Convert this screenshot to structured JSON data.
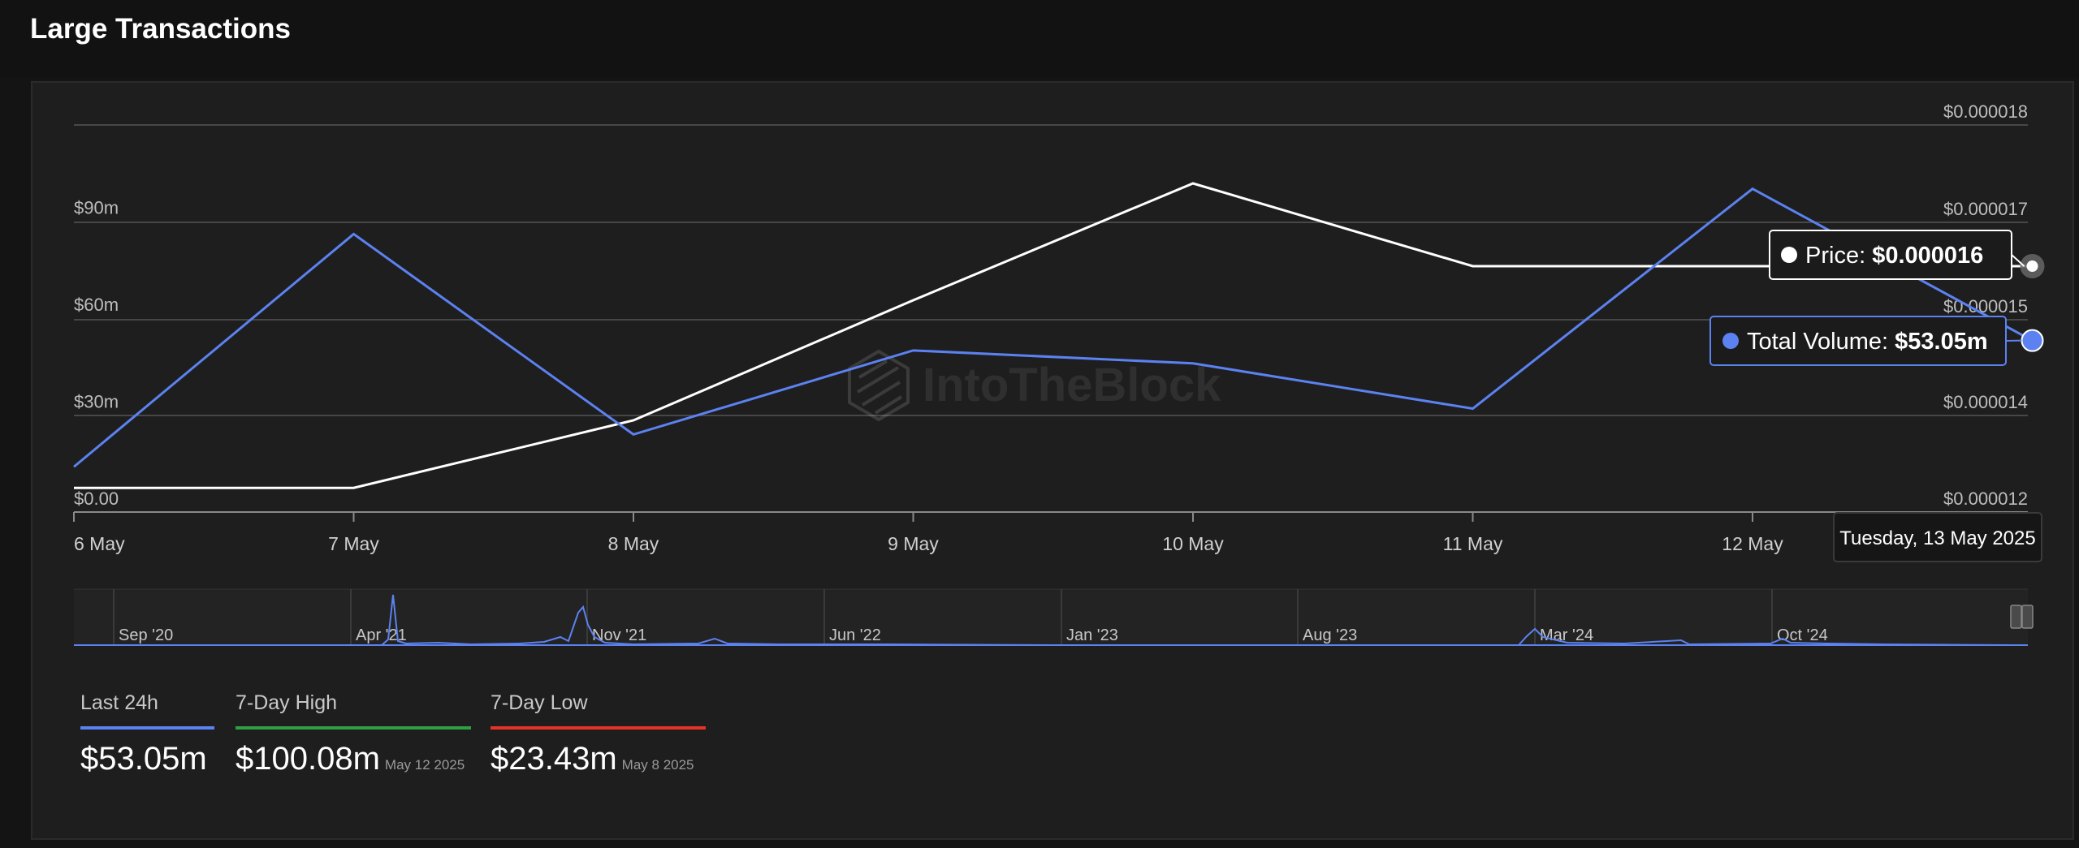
{
  "header": {
    "title": "Large Transactions"
  },
  "colors": {
    "volume": "#5b82f0",
    "price": "#ffffff",
    "high": "#2ea043",
    "low": "#e5332a",
    "grid": "#474747",
    "axis_text": "#bdbdbd"
  },
  "chart_data": {
    "type": "line",
    "x": [
      "6 May",
      "7 May",
      "8 May",
      "9 May",
      "10 May",
      "11 May",
      "12 May",
      "13 May"
    ],
    "x_tick_labels": [
      "6 May",
      "7 May",
      "8 May",
      "9 May",
      "10 May",
      "11 May",
      "12 May"
    ],
    "y_left": {
      "ticks": [
        "$0.00",
        "$30m",
        "$60m",
        "$90m"
      ],
      "unit": "m",
      "range": [
        0,
        120
      ]
    },
    "y_right": {
      "ticks": [
        "$0.000012",
        "$0.000014",
        "$0.000015",
        "$0.000017",
        "$0.000018"
      ]
    },
    "series": [
      {
        "name": "Total Volume",
        "axis": "left",
        "values": [
          14,
          86,
          24,
          50,
          46,
          32,
          100,
          53.05
        ]
      },
      {
        "name": "Price",
        "axis": "right",
        "values": [
          1.25e-05,
          1.25e-05,
          1.39e-05,
          1.54e-05,
          1.74e-05,
          1.61e-05,
          1.61e-05,
          1.61e-05
        ]
      }
    ],
    "tooltip": {
      "date": "Tuesday, 13 May 2025",
      "price_label": "Price:",
      "price_value": "$0.000016",
      "volume_label": "Total Volume:",
      "volume_value": "$53.05m"
    },
    "watermark": "IntoTheBlock",
    "navigator": {
      "labels": [
        "Sep '20",
        "Apr '21",
        "Nov '21",
        "Jun '22",
        "Jan '23",
        "Aug '23",
        "Mar '24",
        "Oct '24"
      ]
    }
  },
  "stats": [
    {
      "label": "Last 24h",
      "value": "$53.05m",
      "date": "",
      "color": "#5b82f0"
    },
    {
      "label": "7-Day High",
      "value": "$100.08m",
      "date": "May 12 2025",
      "color": "#2ea043"
    },
    {
      "label": "7-Day Low",
      "value": "$23.43m",
      "date": "May 8 2025",
      "color": "#e5332a"
    }
  ]
}
